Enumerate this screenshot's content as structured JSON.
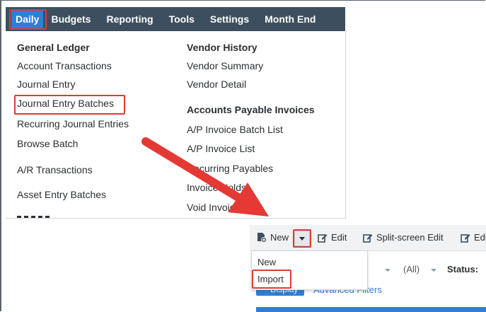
{
  "nav": {
    "items": [
      "Daily",
      "Budgets",
      "Reporting",
      "Tools",
      "Settings",
      "Month End"
    ],
    "active": "Daily"
  },
  "menu": {
    "col1": {
      "heading": "General Ledger",
      "links": [
        "Account Transactions",
        "Journal Entry",
        "Journal Entry Batches",
        "Recurring Journal Entries",
        "Browse Batch"
      ],
      "extra_links": [
        "A/R Transactions",
        "Asset Entry Batches"
      ]
    },
    "col2": {
      "heading1": "Vendor History",
      "links1": [
        "Vendor Summary",
        "Vendor Detail"
      ],
      "heading2": "Accounts Payable Invoices",
      "links2": [
        "A/P Invoice Batch List",
        "A/P Invoice List",
        "Recurring Payables",
        "Invoice Holds",
        "Void Invoice"
      ]
    }
  },
  "toolbar": {
    "new_label": "New",
    "edit_label": "Edit",
    "split_label": "Split-screen Edit",
    "edit2_label": "Edi"
  },
  "dropdown": {
    "items": [
      "New",
      "Import"
    ]
  },
  "filters": {
    "all_value": "(All)",
    "status_label": "Status:",
    "display_label": "Display",
    "advanced_label": "Advanced Filters"
  },
  "colors": {
    "navbar": "#3d4f5f",
    "active": "#2f7fd6",
    "highlight": "#e0393b",
    "arrow": "#e53935"
  }
}
